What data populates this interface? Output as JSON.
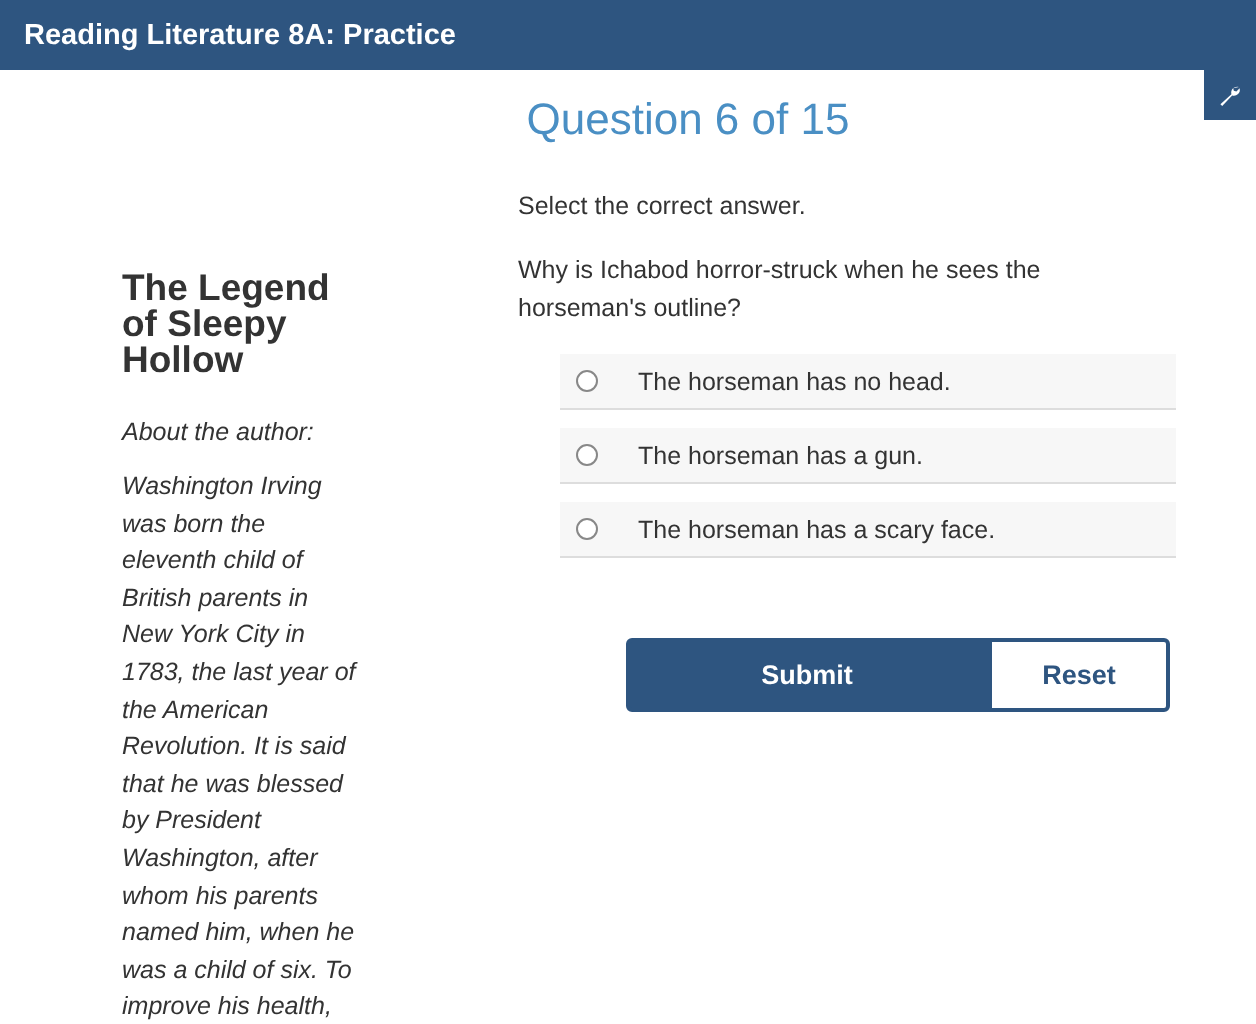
{
  "header": {
    "title": "Reading Literature 8A: Practice"
  },
  "passage": {
    "title": "The Legend of Sleepy Hollow",
    "subtitle": "About the author:",
    "text": "Washington Irving was born the eleventh child of British parents in New York City in 1783, the last year of the American Revolution. It is said that he was blessed by President Washington, after whom his parents named him, when he was a child of six. To improve his health,"
  },
  "question": {
    "heading": "Question 6 of 15",
    "instruction": "Select the correct answer.",
    "prompt": "Why is Ichabod horror-struck when he sees the horseman's outline?",
    "options": [
      {
        "label": "The horseman has no head.",
        "selected": false
      },
      {
        "label": "The horseman has a gun.",
        "selected": false
      },
      {
        "label": "The horseman has a scary face.",
        "selected": false
      }
    ]
  },
  "buttons": [
    {
      "label": "Submit",
      "kind": "primary"
    },
    {
      "label": "Reset",
      "kind": "secondary"
    }
  ]
}
